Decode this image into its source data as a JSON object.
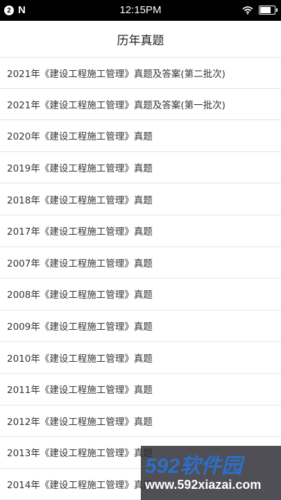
{
  "status_bar": {
    "notification_count": "2",
    "app_icon_letter": "N",
    "time": "12:15PM",
    "battery_level": 0.85
  },
  "header": {
    "title": "历年真题"
  },
  "exam_list": [
    {
      "label": "2021年《建设工程施工管理》真题及答案(第二批次)"
    },
    {
      "label": "2021年《建设工程施工管理》真题及答案(第一批次)"
    },
    {
      "label": "2020年《建设工程施工管理》真题"
    },
    {
      "label": "2019年《建设工程施工管理》真题"
    },
    {
      "label": "2018年《建设工程施工管理》真题"
    },
    {
      "label": "2017年《建设工程施工管理》真题"
    },
    {
      "label": "2007年《建设工程施工管理》真题"
    },
    {
      "label": "2008年《建设工程施工管理》真题"
    },
    {
      "label": "2009年《建设工程施工管理》真题"
    },
    {
      "label": "2010年《建设工程施工管理》真题"
    },
    {
      "label": "2011年《建设工程施工管理》真题"
    },
    {
      "label": "2012年《建设工程施工管理》真题"
    },
    {
      "label": "2013年《建设工程施工管理》真题"
    },
    {
      "label": "2014年《建设工程施工管理》真题"
    }
  ],
  "watermark": {
    "logo_text": "592软件园",
    "url": "www.592xiazai.com"
  }
}
